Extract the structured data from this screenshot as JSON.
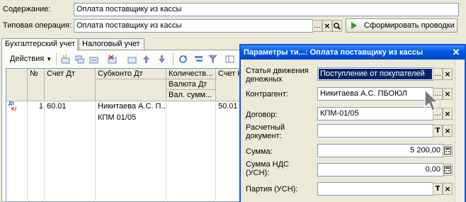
{
  "header": {
    "content_label": "Содержание:",
    "content_value": "Оплата поставщику из кассы",
    "operation_label": "Типовая операция:",
    "operation_value": "Оплата поставщику из кассы",
    "generate_button": "Сформировать проводки"
  },
  "tabs": [
    {
      "label": "Бухгалтерский учет",
      "active": true
    },
    {
      "label": "Налоговый учет",
      "active": false
    }
  ],
  "toolbar": {
    "actions_label": "Действия"
  },
  "grid": {
    "columns": {
      "num": "№",
      "account_dt": "Счет Дт",
      "subkonto_dt": "Субконто Дт",
      "quantity": "Количеств...",
      "currency_dt": "Валюта Дт",
      "currency_sum": "Вал. сумм...",
      "account_kt": "Счет К"
    },
    "rows": [
      {
        "icon_dt": "Дт",
        "icon_kt": "Кт",
        "num": "1",
        "account_dt": "60.01",
        "subkonto_1": "Никитаева А.С. П...",
        "subkonto_2": "КПМ 01/05",
        "account_kt": "50.01"
      }
    ]
  },
  "dialog": {
    "title": "Параметры ти...:  Оплата поставщику из кассы",
    "fields": [
      {
        "label": "Статья движения денежных",
        "value": "Поступление от покупателей",
        "selected": true
      },
      {
        "label": "Контрагент:",
        "value": "Никитаева А.С. ПБОЮЛ"
      },
      {
        "label": "Договор:",
        "value": "КПМ-01/05"
      },
      {
        "label": "Расчетный документ:",
        "value": ""
      },
      {
        "label": "Сумма:",
        "value": "5 200,00"
      },
      {
        "label": "Сумма НДС (УСН):",
        "value": "0,00"
      },
      {
        "label": "Партия (УСН):",
        "value": ""
      }
    ]
  },
  "icons": {
    "ellipsis": "...",
    "clear": "×",
    "search": "search-icon",
    "type_t": "T",
    "calculator": "calculator-icon"
  },
  "colors": {
    "window_bg": "#ece9d8",
    "title_bar": "#0058e6",
    "selection": "#0a246a",
    "field_border": "#7f9db9"
  }
}
